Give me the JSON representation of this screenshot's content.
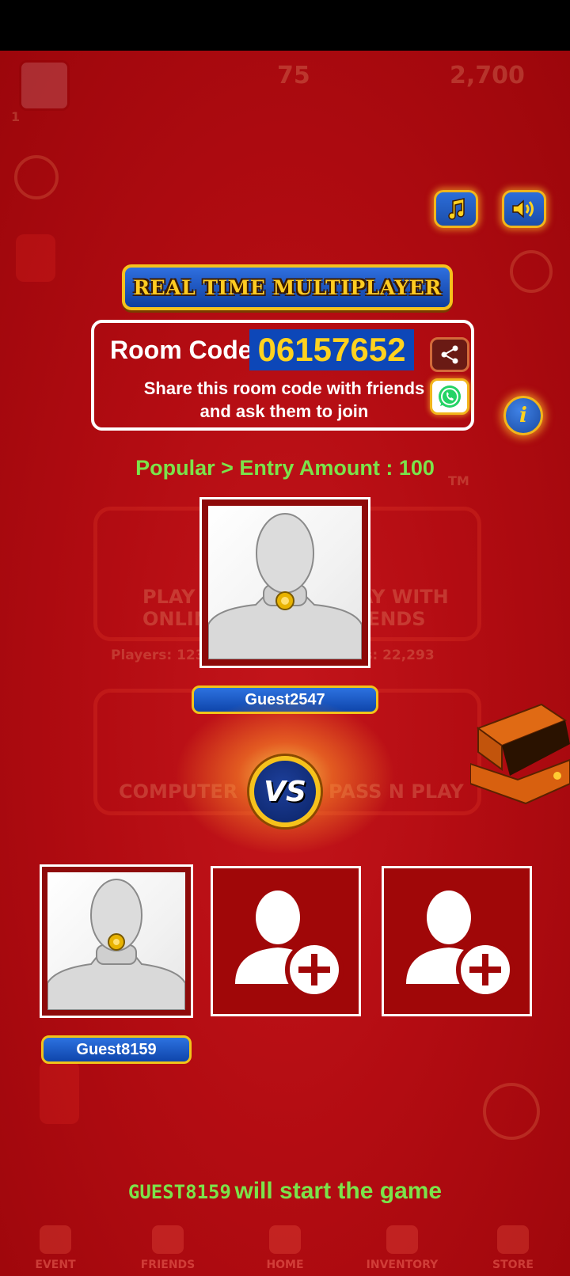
{
  "background": {
    "top_bar": {
      "coins_small": "75",
      "coins_large": "2,700",
      "level": "1"
    },
    "menu": {
      "play_online": "PLAY\nONLINE",
      "play_friends": "PLAY WITH\nFRIENDS",
      "players_online": "Players: 123,146",
      "players_friends": "Players: 22,293",
      "computer": "COMPUTER",
      "pass_n_play": "PASS N PLAY",
      "trademark": "TM"
    },
    "nav": [
      {
        "label": "EVENT"
      },
      {
        "label": "FRIENDS"
      },
      {
        "label": "HOME"
      },
      {
        "label": "INVENTORY"
      },
      {
        "label": "STORE"
      }
    ]
  },
  "header": {
    "title": "REAL TIME MULTIPLAYER"
  },
  "room": {
    "label": "Room Code :",
    "code": "06157652",
    "description": "Share this room code with friends and ask them to join"
  },
  "entry": {
    "text": "Popular > Entry Amount : 100"
  },
  "players": {
    "host": {
      "name": "Guest2547"
    },
    "slot1": {
      "name": "Guest8159"
    }
  },
  "vs": {
    "label": "VS"
  },
  "footer": {
    "starter_name": "GUEST8159",
    "starter_message": "will start the game"
  },
  "colors": {
    "bg_red": "#b1080e",
    "accent_gold": "#f6c21c",
    "button_blue": "#1b4eaa",
    "highlight_green": "#7be34a"
  }
}
